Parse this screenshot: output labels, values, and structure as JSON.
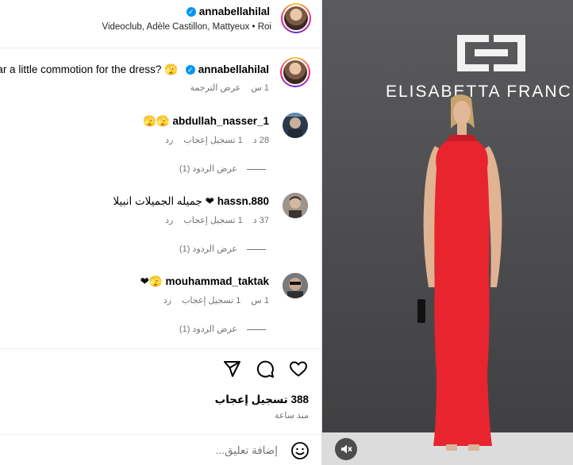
{
  "header": {
    "username": "annabellahilal",
    "audio": "Videoclub, Adèle Castillon, Mattyeux • Roi"
  },
  "caption": {
    "username": "annabellahilal",
    "text": "ear a little commotion for the dress? 🫣",
    "time": "1 س",
    "translate": "عرض الترجمة"
  },
  "comments": [
    {
      "username": "abdullah_nasser_1",
      "text": "🫣🫣",
      "time": "28 د",
      "likes": "1 تسجيل إعجاب",
      "reply": "رد",
      "view_replies": "عرض الردود (1)"
    },
    {
      "username": "hassn.880",
      "text": "جميله الجميلات انبيلا ❤",
      "time": "37 د",
      "likes": "1 تسجيل إعجاب",
      "reply": "رد",
      "view_replies": "عرض الردود (1)"
    },
    {
      "username": "mouhammad_taktak",
      "text": "❤🫣",
      "time": "1 س",
      "likes": "1 تسجيل إعجاب",
      "reply": "رد",
      "view_replies": "عرض الردود (1)"
    }
  ],
  "footer": {
    "likes_count": "388 تسجيل إعجاب",
    "time_ago": "منذ ساعة",
    "add_comment_placeholder": "إضافة تعليق..."
  },
  "media": {
    "brand_name": "ELISABETTA FRANC",
    "dress_color": "#e8242e",
    "wall_color": "#4a4a4c",
    "floor_color": "#dcdcdc"
  },
  "icons": {
    "verified": "verified-badge-icon",
    "like": "heart-icon",
    "comment": "comment-bubble-icon",
    "share": "send-icon",
    "emoji": "emoji-icon",
    "mute": "speaker-muted-icon"
  }
}
